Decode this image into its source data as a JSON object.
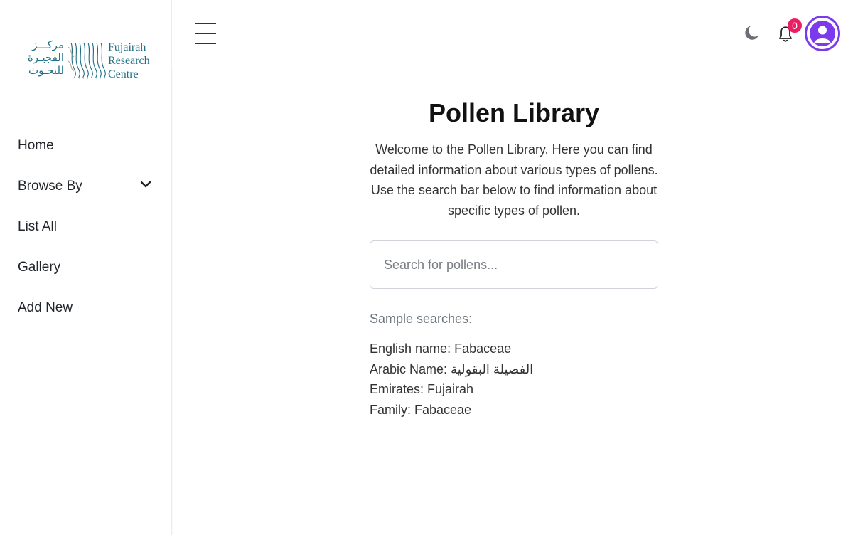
{
  "sidebar": {
    "logo": {
      "arabic_lines": [
        "مركـــز",
        "الفجيـرة",
        "للبحـوث"
      ],
      "english_lines": [
        "Fujairah",
        "Research",
        "Centre"
      ]
    },
    "items": [
      {
        "label": "Home"
      },
      {
        "label": "Browse By",
        "icon": "chevron-down-icon"
      },
      {
        "label": "List All"
      },
      {
        "label": "Gallery"
      },
      {
        "label": "Add New"
      }
    ]
  },
  "header": {
    "notification_count": "0",
    "icons": [
      "hamburger-icon",
      "moon-icon",
      "bell-icon",
      "user-icon"
    ]
  },
  "main": {
    "title": "Pollen Library",
    "intro": "Welcome to the Pollen Library. Here you can find detailed information about various types of pollens. Use the search bar below to find information about specific types of pollen.",
    "search": {
      "placeholder": "Search for pollens...",
      "value": ""
    },
    "samples_title": "Sample searches:",
    "samples": [
      "English name: Fabaceae",
      "Arabic Name: الفصيلة البقولية",
      "Emirates: Fujairah",
      "Family: Fabaceae"
    ]
  },
  "colors": {
    "brand_teal": "#1f6f86",
    "accent_purple": "#7c3aed",
    "badge_pink": "#e91e63",
    "moon_gray": "#6b6f75"
  }
}
